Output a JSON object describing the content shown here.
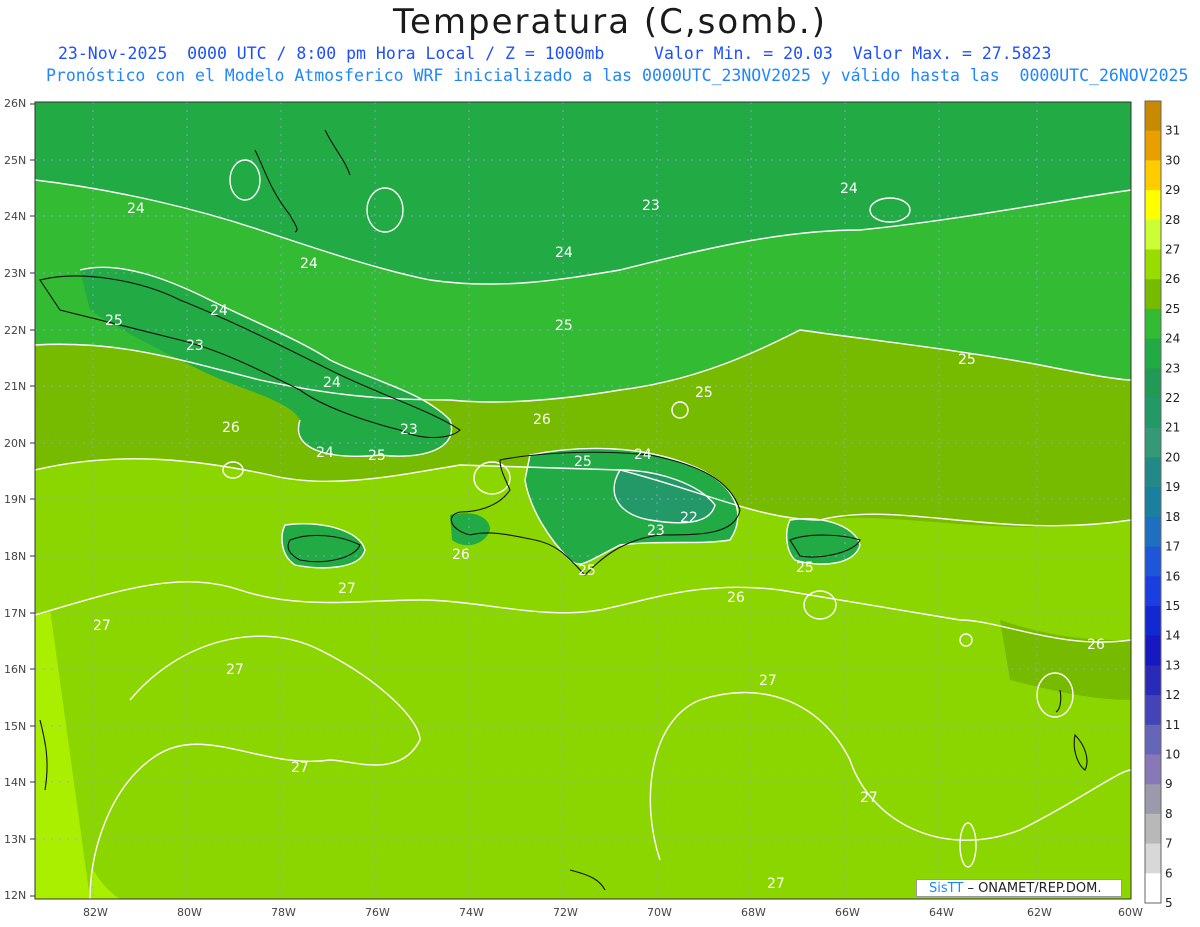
{
  "header": {
    "title": "Temperatura (C,somb.)",
    "line1": "23-Nov-2025  0000 UTC / 8:00 pm Hora Local / Z = 1000mb     Valor Min. = 20.03  Valor Max. = 27.5823",
    "line2": "Pronóstico con el Modelo Atmosferico WRF inicializado a las 0000UTC_23NOV2025 y válido hasta las  0000UTC_26NOV2025"
  },
  "map": {
    "lat_labels": [
      "26N",
      "25N",
      "24N",
      "23N",
      "22N",
      "21N",
      "20N",
      "19N",
      "18N",
      "17N",
      "16N",
      "15N",
      "14N",
      "13N",
      "12N"
    ],
    "lon_labels": [
      "82W",
      "80W",
      "78W",
      "76W",
      "74W",
      "72W",
      "70W",
      "68W",
      "66W",
      "64W",
      "62W",
      "60W"
    ],
    "contour_labels": [
      "24",
      "23",
      "24",
      "24",
      "24",
      "25",
      "24",
      "23",
      "25",
      "25",
      "24",
      "25",
      "26",
      "24",
      "23",
      "25",
      "26",
      "25",
      "24",
      "23",
      "22",
      "26",
      "27",
      "25",
      "26",
      "25",
      "27",
      "27",
      "27",
      "27",
      "26",
      "27",
      "27"
    ]
  },
  "colorbar": {
    "labels": [
      "31",
      "30",
      "29",
      "28",
      "27",
      "26",
      "25",
      "24",
      "23",
      "22",
      "21",
      "20",
      "19",
      "18",
      "17",
      "16",
      "15",
      "14",
      "13",
      "12",
      "11",
      "10",
      "9",
      "8",
      "7",
      "6",
      "5"
    ],
    "colors": [
      "#c88a00",
      "#e8a000",
      "#ffcc00",
      "#ffff00",
      "#ccff33",
      "#99dd00",
      "#77bb00",
      "#33bb33",
      "#22aa44",
      "#229955",
      "#229966",
      "#339977",
      "#228888",
      "#1b7fa0",
      "#1e6fc0",
      "#1f55d8",
      "#1a3ee0",
      "#1228d0",
      "#1818c0",
      "#2a2ab8",
      "#4444b8",
      "#6666b8",
      "#8878b8",
      "#9a9aaa",
      "#b8b8b8",
      "#d8d8d8",
      "#ffffff"
    ]
  },
  "credit": {
    "brand": "SisTT",
    "text": "– ONAMET/REP.DOM."
  }
}
